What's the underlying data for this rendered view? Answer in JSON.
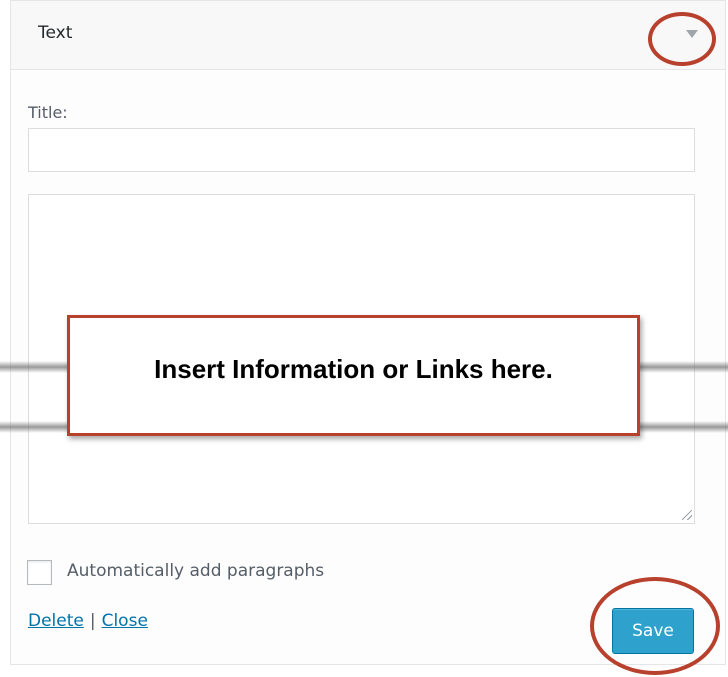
{
  "widget": {
    "title": "Text",
    "toggle_icon": "triangle-down-icon"
  },
  "form": {
    "title_label": "Title:",
    "title_value": "",
    "content_value": "",
    "autop_label": "Automatically add paragraphs",
    "autop_checked": false
  },
  "actions": {
    "delete_label": "Delete",
    "separator": "|",
    "close_label": "Close",
    "save_label": "Save"
  },
  "annotation": {
    "callout_text": "Insert Information or Links here.",
    "highlight_color": "#b8412d"
  },
  "colors": {
    "link": "#0073aa",
    "save_button": "#2ea2cc",
    "header_bg": "#f8f8f8"
  }
}
